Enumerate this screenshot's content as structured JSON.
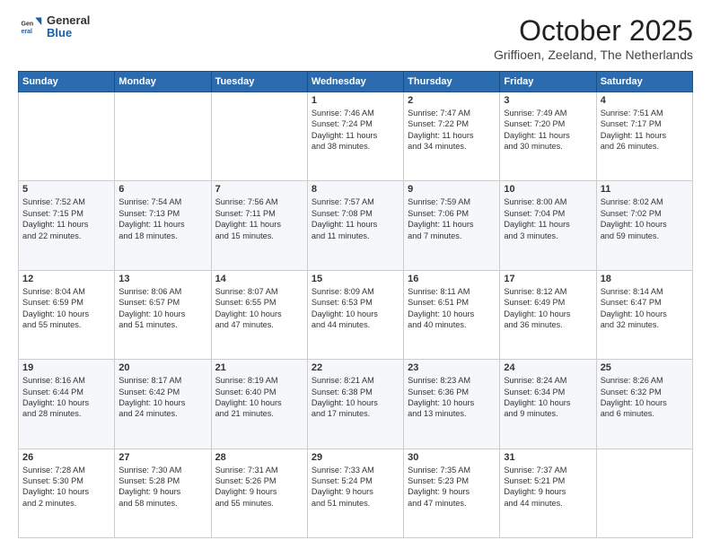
{
  "header": {
    "logo_general": "General",
    "logo_blue": "Blue",
    "month": "October 2025",
    "location": "Griffioen, Zeeland, The Netherlands"
  },
  "columns": [
    "Sunday",
    "Monday",
    "Tuesday",
    "Wednesday",
    "Thursday",
    "Friday",
    "Saturday"
  ],
  "weeks": [
    [
      {
        "day": "",
        "info": ""
      },
      {
        "day": "",
        "info": ""
      },
      {
        "day": "",
        "info": ""
      },
      {
        "day": "1",
        "info": "Sunrise: 7:46 AM\nSunset: 7:24 PM\nDaylight: 11 hours\nand 38 minutes."
      },
      {
        "day": "2",
        "info": "Sunrise: 7:47 AM\nSunset: 7:22 PM\nDaylight: 11 hours\nand 34 minutes."
      },
      {
        "day": "3",
        "info": "Sunrise: 7:49 AM\nSunset: 7:20 PM\nDaylight: 11 hours\nand 30 minutes."
      },
      {
        "day": "4",
        "info": "Sunrise: 7:51 AM\nSunset: 7:17 PM\nDaylight: 11 hours\nand 26 minutes."
      }
    ],
    [
      {
        "day": "5",
        "info": "Sunrise: 7:52 AM\nSunset: 7:15 PM\nDaylight: 11 hours\nand 22 minutes."
      },
      {
        "day": "6",
        "info": "Sunrise: 7:54 AM\nSunset: 7:13 PM\nDaylight: 11 hours\nand 18 minutes."
      },
      {
        "day": "7",
        "info": "Sunrise: 7:56 AM\nSunset: 7:11 PM\nDaylight: 11 hours\nand 15 minutes."
      },
      {
        "day": "8",
        "info": "Sunrise: 7:57 AM\nSunset: 7:08 PM\nDaylight: 11 hours\nand 11 minutes."
      },
      {
        "day": "9",
        "info": "Sunrise: 7:59 AM\nSunset: 7:06 PM\nDaylight: 11 hours\nand 7 minutes."
      },
      {
        "day": "10",
        "info": "Sunrise: 8:00 AM\nSunset: 7:04 PM\nDaylight: 11 hours\nand 3 minutes."
      },
      {
        "day": "11",
        "info": "Sunrise: 8:02 AM\nSunset: 7:02 PM\nDaylight: 10 hours\nand 59 minutes."
      }
    ],
    [
      {
        "day": "12",
        "info": "Sunrise: 8:04 AM\nSunset: 6:59 PM\nDaylight: 10 hours\nand 55 minutes."
      },
      {
        "day": "13",
        "info": "Sunrise: 8:06 AM\nSunset: 6:57 PM\nDaylight: 10 hours\nand 51 minutes."
      },
      {
        "day": "14",
        "info": "Sunrise: 8:07 AM\nSunset: 6:55 PM\nDaylight: 10 hours\nand 47 minutes."
      },
      {
        "day": "15",
        "info": "Sunrise: 8:09 AM\nSunset: 6:53 PM\nDaylight: 10 hours\nand 44 minutes."
      },
      {
        "day": "16",
        "info": "Sunrise: 8:11 AM\nSunset: 6:51 PM\nDaylight: 10 hours\nand 40 minutes."
      },
      {
        "day": "17",
        "info": "Sunrise: 8:12 AM\nSunset: 6:49 PM\nDaylight: 10 hours\nand 36 minutes."
      },
      {
        "day": "18",
        "info": "Sunrise: 8:14 AM\nSunset: 6:47 PM\nDaylight: 10 hours\nand 32 minutes."
      }
    ],
    [
      {
        "day": "19",
        "info": "Sunrise: 8:16 AM\nSunset: 6:44 PM\nDaylight: 10 hours\nand 28 minutes."
      },
      {
        "day": "20",
        "info": "Sunrise: 8:17 AM\nSunset: 6:42 PM\nDaylight: 10 hours\nand 24 minutes."
      },
      {
        "day": "21",
        "info": "Sunrise: 8:19 AM\nSunset: 6:40 PM\nDaylight: 10 hours\nand 21 minutes."
      },
      {
        "day": "22",
        "info": "Sunrise: 8:21 AM\nSunset: 6:38 PM\nDaylight: 10 hours\nand 17 minutes."
      },
      {
        "day": "23",
        "info": "Sunrise: 8:23 AM\nSunset: 6:36 PM\nDaylight: 10 hours\nand 13 minutes."
      },
      {
        "day": "24",
        "info": "Sunrise: 8:24 AM\nSunset: 6:34 PM\nDaylight: 10 hours\nand 9 minutes."
      },
      {
        "day": "25",
        "info": "Sunrise: 8:26 AM\nSunset: 6:32 PM\nDaylight: 10 hours\nand 6 minutes."
      }
    ],
    [
      {
        "day": "26",
        "info": "Sunrise: 7:28 AM\nSunset: 5:30 PM\nDaylight: 10 hours\nand 2 minutes."
      },
      {
        "day": "27",
        "info": "Sunrise: 7:30 AM\nSunset: 5:28 PM\nDaylight: 9 hours\nand 58 minutes."
      },
      {
        "day": "28",
        "info": "Sunrise: 7:31 AM\nSunset: 5:26 PM\nDaylight: 9 hours\nand 55 minutes."
      },
      {
        "day": "29",
        "info": "Sunrise: 7:33 AM\nSunset: 5:24 PM\nDaylight: 9 hours\nand 51 minutes."
      },
      {
        "day": "30",
        "info": "Sunrise: 7:35 AM\nSunset: 5:23 PM\nDaylight: 9 hours\nand 47 minutes."
      },
      {
        "day": "31",
        "info": "Sunrise: 7:37 AM\nSunset: 5:21 PM\nDaylight: 9 hours\nand 44 minutes."
      },
      {
        "day": "",
        "info": ""
      }
    ]
  ]
}
